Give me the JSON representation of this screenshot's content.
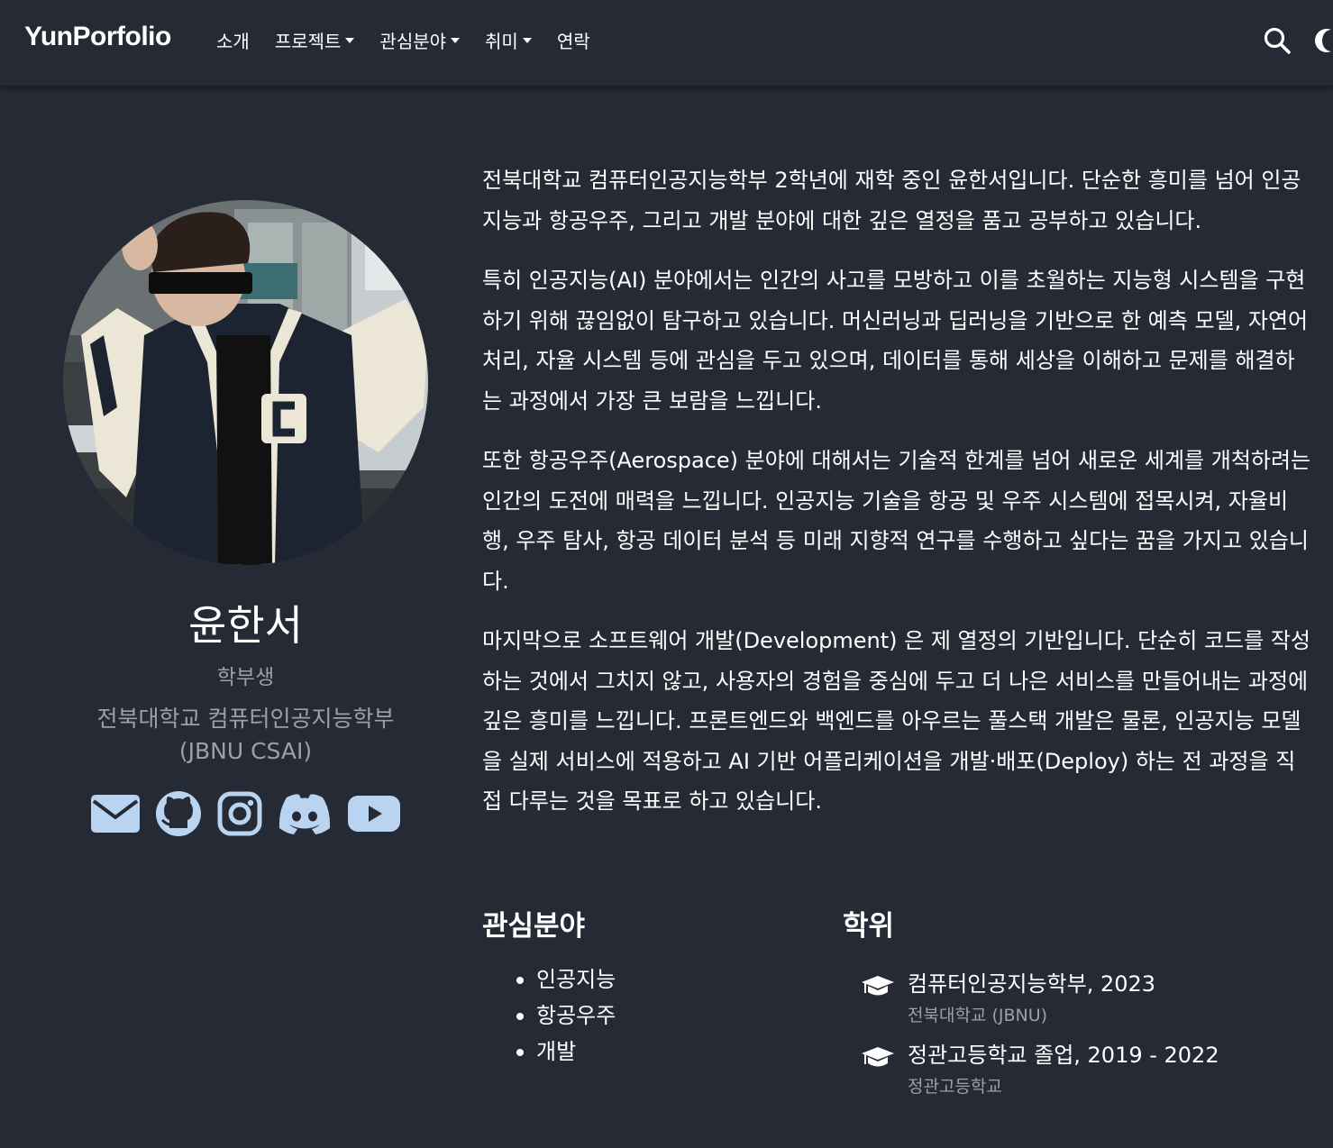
{
  "navbar": {
    "brand": "YunPorfolio",
    "items": [
      {
        "label": "소개",
        "dropdown": false
      },
      {
        "label": "프로젝트",
        "dropdown": true
      },
      {
        "label": "관심분야",
        "dropdown": true
      },
      {
        "label": "취미",
        "dropdown": true
      },
      {
        "label": "연락",
        "dropdown": false
      }
    ],
    "icons": [
      "search-icon",
      "dark-mode-moon-icon"
    ]
  },
  "profile": {
    "name": "윤한서",
    "role": "학부생",
    "affiliation_line1": "전북대학교 컴퓨터인공지능학부",
    "affiliation_line2": "(JBNU CSAI)",
    "social_icons": [
      "email-icon",
      "github-icon",
      "instagram-icon",
      "discord-icon",
      "youtube-icon"
    ],
    "icon_color": "#b8d4f0"
  },
  "about": {
    "paragraphs": [
      "전북대학교 컴퓨터인공지능학부 2학년에 재학 중인 윤한서입니다. 단순한 흥미를 넘어 인공지능과 항공우주, 그리고 개발 분야에 대한 깊은 열정을 품고 공부하고 있습니다.",
      "특히 인공지능(AI) 분야에서는 인간의 사고를 모방하고 이를 초월하는 지능형 시스템을 구현하기 위해 끊임없이 탐구하고 있습니다. 머신러닝과 딥러닝을 기반으로 한 예측 모델, 자연어 처리, 자율 시스템 등에 관심을 두고 있으며, 데이터를 통해 세상을 이해하고 문제를 해결하는 과정에서 가장 큰 보람을 느낍니다.",
      "또한 항공우주(Aerospace) 분야에 대해서는 기술적 한계를 넘어 새로운 세계를 개척하려는 인간의 도전에 매력을 느낍니다. 인공지능 기술을 항공 및 우주 시스템에 접목시켜, 자율비행, 우주 탐사, 항공 데이터 분석 등 미래 지향적 연구를 수행하고 싶다는 꿈을 가지고 있습니다.",
      "마지막으로 소프트웨어 개발(Development) 은 제 열정의 기반입니다. 단순히 코드를 작성하는 것에서 그치지 않고, 사용자의 경험을 중심에 두고 더 나은 서비스를 만들어내는 과정에 깊은 흥미를 느낍니다. 프론트엔드와 백엔드를 아우르는 풀스택 개발은 물론, 인공지능 모델을 실제 서비스에 적용하고 AI 기반 어플리케이션을 개발·배포(Deploy) 하는 전 과정을 직접 다루는 것을 목표로 하고 있습니다."
    ]
  },
  "interests": {
    "heading": "관심분야",
    "items": [
      "인공지능",
      "항공우주",
      "개발"
    ]
  },
  "education": {
    "heading": "학위",
    "items": [
      {
        "title": "컴퓨터인공지능학부, 2023",
        "institution": "전북대학교 (JBNU)"
      },
      {
        "title": "정관고등학교 졸업, 2019 - 2022",
        "institution": "정관고등학교"
      }
    ]
  }
}
